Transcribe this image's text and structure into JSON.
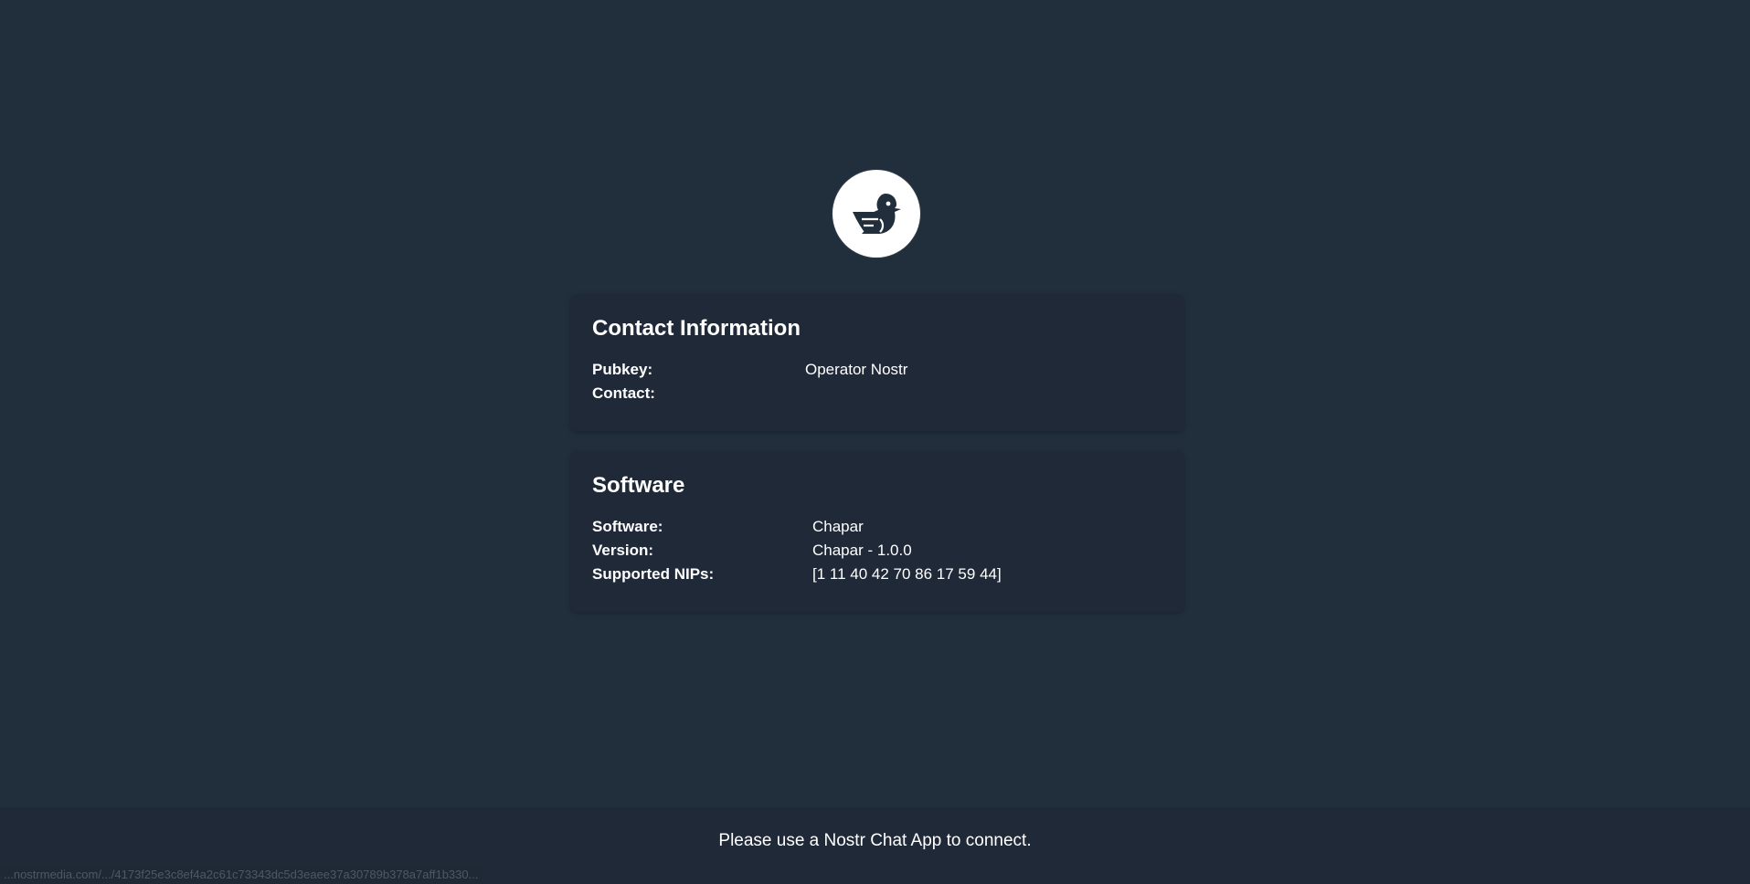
{
  "logo": {
    "icon": "bird-icon",
    "background": "#ffffff",
    "foreground": "#212f3d"
  },
  "contact": {
    "title": "Contact Information",
    "rows": [
      {
        "label": "Pubkey:",
        "value": "Operator Nostr"
      },
      {
        "label": "Contact:",
        "value": ""
      }
    ]
  },
  "software": {
    "title": "Software",
    "rows": [
      {
        "label": "Software:",
        "value": "Chapar"
      },
      {
        "label": "Version:",
        "value": "Chapar - 1.0.0"
      },
      {
        "label": "Supported NIPs:",
        "value": "[1 11 40 42 70 86 17 59 44]"
      }
    ]
  },
  "footer": {
    "message": "Please use a Nostr Chat App to connect."
  },
  "status_bar": {
    "url": "...nostrmedia.com/.../4173f25e3c8ef4a2c61c73343dc5d3eaee37a30789b378a7aff1b330..."
  },
  "colors": {
    "page_background": "#212f3d",
    "card_background": "#202938",
    "text": "#ffffff"
  }
}
